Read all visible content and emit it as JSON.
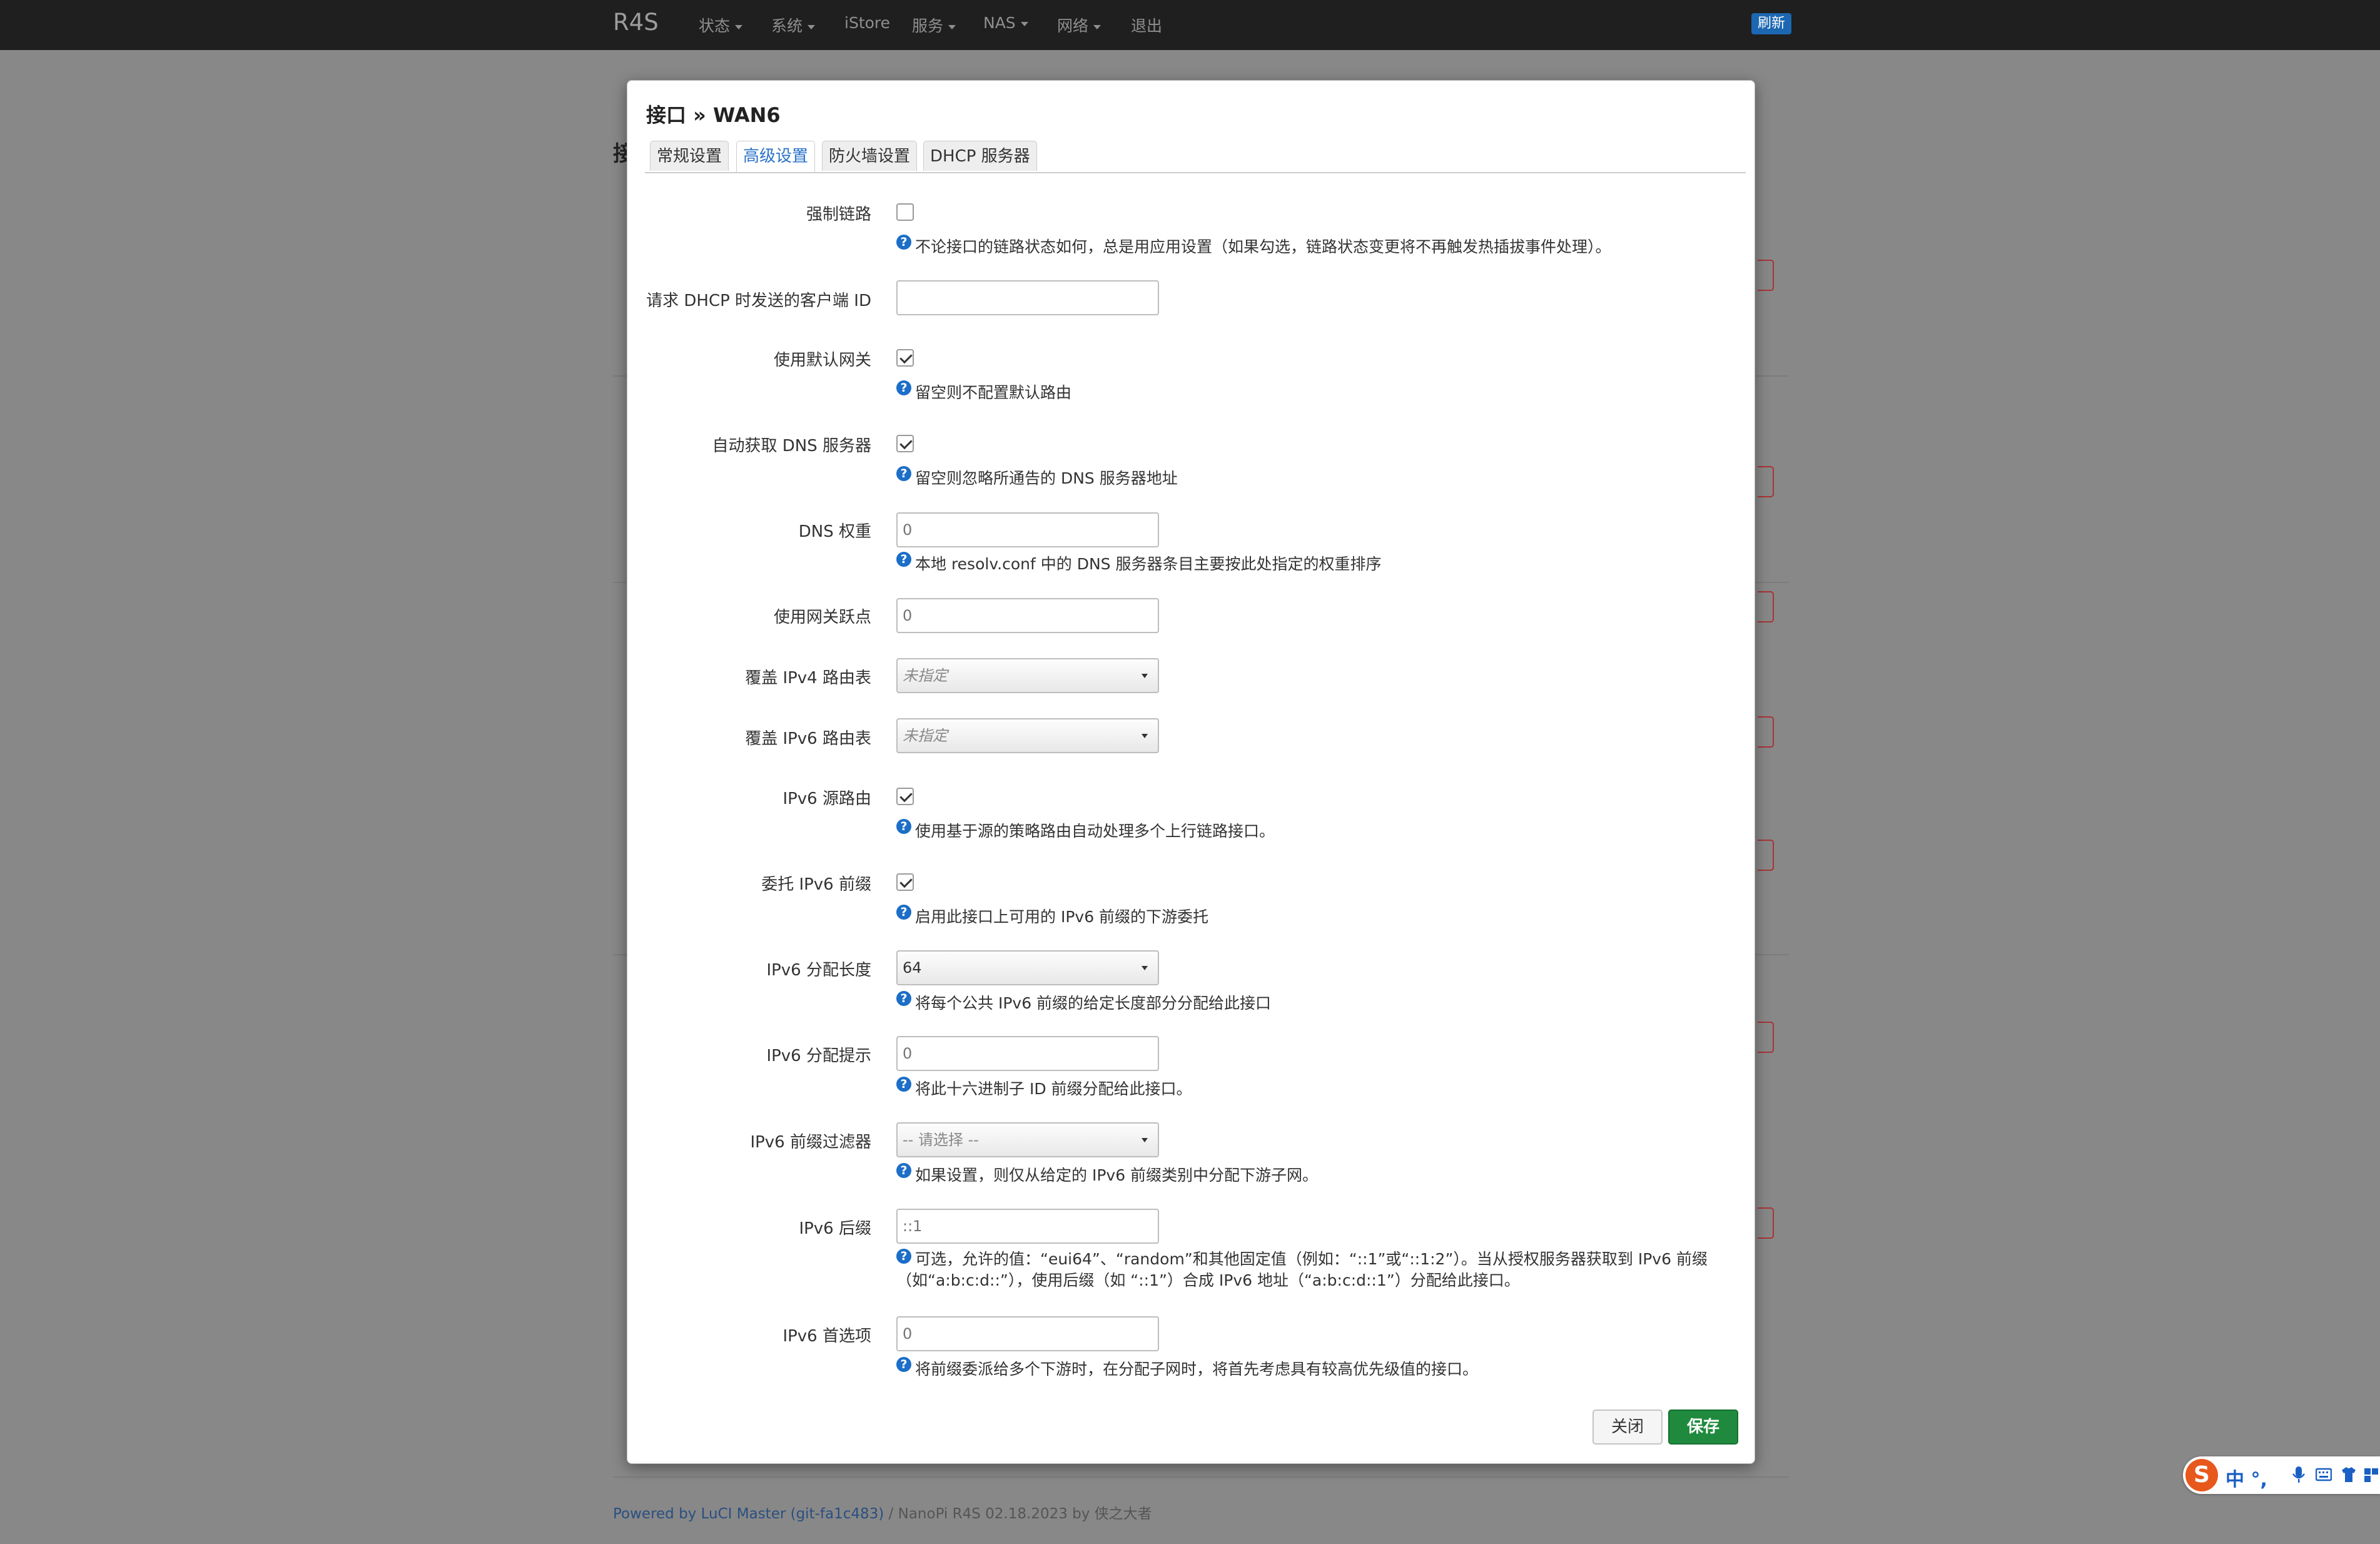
{
  "navbar": {
    "brand": "R4S",
    "items": [
      {
        "label": "状态",
        "dropdown": true
      },
      {
        "label": "系统",
        "dropdown": true
      },
      {
        "label": "iStore",
        "dropdown": false
      },
      {
        "label": "服务",
        "dropdown": true
      },
      {
        "label": "NAS",
        "dropdown": true
      },
      {
        "label": "网络",
        "dropdown": true
      },
      {
        "label": "退出",
        "dropdown": false
      }
    ],
    "refresh_label": "刷新"
  },
  "background_partial_text": "接",
  "footer": {
    "link": "Powered by LuCI Master (git-fa1c483)",
    "rest": " / NanoPi R4S 02.18.2023 by 侠之大者"
  },
  "modal": {
    "title": "接口 » WAN6",
    "tabs": [
      {
        "label": "常规设置",
        "active": false
      },
      {
        "label": "高级设置",
        "active": true
      },
      {
        "label": "防火墙设置",
        "active": false
      },
      {
        "label": "DHCP 服务器",
        "active": false
      }
    ],
    "fields": {
      "force_link": {
        "label": "强制链路",
        "checked": false,
        "help": "不论接口的链路状态如何，总是用应用设置（如果勾选，链路状态变更将不再触发热插拔事件处理）。"
      },
      "client_id": {
        "label": "请求 DHCP 时发送的客户端 ID",
        "value": "",
        "placeholder": ""
      },
      "default_gw": {
        "label": "使用默认网关",
        "checked": true,
        "help": "留空则不配置默认路由"
      },
      "peer_dns": {
        "label": "自动获取 DNS 服务器",
        "checked": true,
        "help": "留空则忽略所通告的 DNS 服务器地址"
      },
      "dns_weight": {
        "label": "DNS 权重",
        "placeholder": "0",
        "help": "本地 resolv.conf 中的 DNS 服务器条目主要按此处指定的权重排序"
      },
      "metric": {
        "label": "使用网关跃点",
        "placeholder": "0"
      },
      "ipv4_table": {
        "label": "覆盖 IPv4 路由表",
        "selected": "未指定"
      },
      "ipv6_table": {
        "label": "覆盖 IPv6 路由表",
        "selected": "未指定"
      },
      "source_routing": {
        "label": "IPv6 源路由",
        "checked": true,
        "help": "使用基于源的策略路由自动处理多个上行链路接口。"
      },
      "delegate": {
        "label": "委托 IPv6 前缀",
        "checked": true,
        "help": "启用此接口上可用的 IPv6 前缀的下游委托"
      },
      "ip6assign": {
        "label": "IPv6 分配长度",
        "selected": "64",
        "help": "将每个公共 IPv6 前缀的给定长度部分分配给此接口"
      },
      "ip6hint": {
        "label": "IPv6 分配提示",
        "placeholder": "0",
        "help": "将此十六进制子 ID 前缀分配给此接口。"
      },
      "ip6class": {
        "label": "IPv6 前缀过滤器",
        "selected": "-- 请选择 --",
        "help": "如果设置，则仅从给定的 IPv6 前缀类别中分配下游子网。"
      },
      "ip6ifaceid": {
        "label": "IPv6 后缀",
        "placeholder": "::1",
        "help": "可选，允许的值：“eui64”、“random”和其他固定值（例如：“::1”或“::1:2”）。当从授权服务器获取到 IPv6 前缀（如“a:b:c:d::”），使用后缀（如 “::1”）合成 IPv6 地址（“a:b:c:d::1”）分配给此接口。"
      },
      "ip6weight": {
        "label": "IPv6 首选项",
        "placeholder": "0",
        "help": "将前缀委派给多个下游时，在分配子网时，将首先考虑具有较高优先级值的接口。"
      }
    },
    "buttons": {
      "close": "关闭",
      "save": "保存"
    }
  },
  "ime": {
    "logo": "S",
    "text": "中 °,"
  },
  "colors": {
    "save": "#1f8a3d",
    "help_icon": "#1c6ec8",
    "active_tab": "#2a72c8",
    "navbar": "#1f1f1f"
  }
}
